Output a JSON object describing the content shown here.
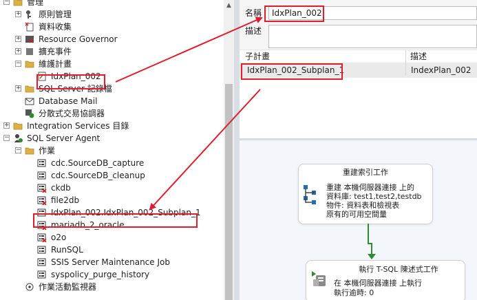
{
  "explorer": {
    "items": [
      {
        "label": "管理",
        "icon": "folder-icon",
        "expander": "−"
      },
      {
        "label": "原則管理",
        "icon": "policy-icon",
        "expander": "+"
      },
      {
        "label": "資料收集",
        "icon": "data-collection-icon",
        "expander": ""
      },
      {
        "label": "Resource Governor",
        "icon": "resource-governor-icon",
        "expander": "+"
      },
      {
        "label": "擴充事件",
        "icon": "extended-events-icon",
        "expander": "+"
      },
      {
        "label": "維護計畫",
        "icon": "folder-icon",
        "expander": "−"
      },
      {
        "label": "IdxPlan_002",
        "icon": "maintenance-plan-icon",
        "expander": ""
      },
      {
        "label": "SQL Server 記錄檔",
        "icon": "folder-icon",
        "expander": "+"
      },
      {
        "label": "Database Mail",
        "icon": "database-mail-icon",
        "expander": ""
      },
      {
        "label": "分散式交易協調器",
        "icon": "dtc-icon",
        "expander": ""
      },
      {
        "label": "Integration Services 目錄",
        "icon": "folder-icon",
        "expander": "+"
      },
      {
        "label": "SQL Server Agent",
        "icon": "sql-agent-icon",
        "expander": "−"
      },
      {
        "label": "作業",
        "icon": "folder-icon",
        "expander": "−"
      },
      {
        "label": "cdc.SourceDB_capture",
        "icon": "job-icon",
        "expander": ""
      },
      {
        "label": "cdc.SourceDB_cleanup",
        "icon": "job-icon",
        "expander": ""
      },
      {
        "label": "ckdb",
        "icon": "job-failed-icon",
        "expander": ""
      },
      {
        "label": "file2db",
        "icon": "job-failed-icon",
        "expander": ""
      },
      {
        "label": "IdxPlan_002.IdxPlan_002_Subplan_1",
        "icon": "job-icon",
        "expander": ""
      },
      {
        "label": "mariadb_2_oracle",
        "icon": "job-failed-icon",
        "expander": ""
      },
      {
        "label": "o2o",
        "icon": "job-failed-icon",
        "expander": ""
      },
      {
        "label": "RunSQL",
        "icon": "job-icon",
        "expander": ""
      },
      {
        "label": "SSIS Server Maintenance Job",
        "icon": "job-icon",
        "expander": ""
      },
      {
        "label": "syspolicy_purge_history",
        "icon": "job-icon",
        "expander": ""
      },
      {
        "label": "作業活動監視器",
        "icon": "job-monitor-icon",
        "expander": ""
      }
    ]
  },
  "plan": {
    "name_label": "名稱",
    "name_value": "IdxPlan_002",
    "desc_label": "描述",
    "desc_value": "",
    "grid": {
      "col_subplan": "子計畫",
      "col_desc": "描述",
      "rows": [
        {
          "subplan": "IdxPlan_002_Subplan_1",
          "desc": "IndexPlan_002"
        }
      ]
    },
    "tasks": [
      {
        "title": "重建索引工作",
        "icon": "rebuild-index-icon",
        "lines": [
          "重建 本機伺服器連接 上的",
          "資料庫: test1,test2,testdb",
          "物件: 資料表和檢視表",
          "原有的可用空間量"
        ]
      },
      {
        "title": "執行 T-SQL 陳述式工作",
        "icon": "tsql-task-icon",
        "lines": [
          "在 本機伺服器連接 上執行",
          "執行逾時: 0"
        ]
      }
    ]
  },
  "colors": {
    "highlight": "#e21c2c",
    "precedence": "#2e8b2e",
    "folder": "#dcb046",
    "failed": "#d42020"
  }
}
